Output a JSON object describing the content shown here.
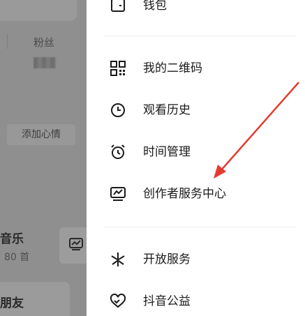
{
  "profile": {
    "fans_label": "粉丝",
    "mood_button": "添加心情",
    "music": {
      "title": "音乐",
      "count": "80 首"
    },
    "friends_label": "朋友"
  },
  "drawer": {
    "items": [
      {
        "label": "钱包",
        "icon": "wallet-icon"
      },
      {
        "label": "我的二维码",
        "icon": "qr-code-icon"
      },
      {
        "label": "观看历史",
        "icon": "clock-icon"
      },
      {
        "label": "时间管理",
        "icon": "alarm-clock-icon"
      },
      {
        "label": "创作者服务中心",
        "icon": "creator-chart-icon"
      },
      {
        "label": "开放服务",
        "icon": "sparkle-icon"
      },
      {
        "label": "抖音公益",
        "icon": "heart-hands-icon"
      }
    ]
  },
  "colors": {
    "overlay": "#8f8f8f",
    "text": "#1a1a1a",
    "annotation_arrow": "#e53a2f"
  }
}
